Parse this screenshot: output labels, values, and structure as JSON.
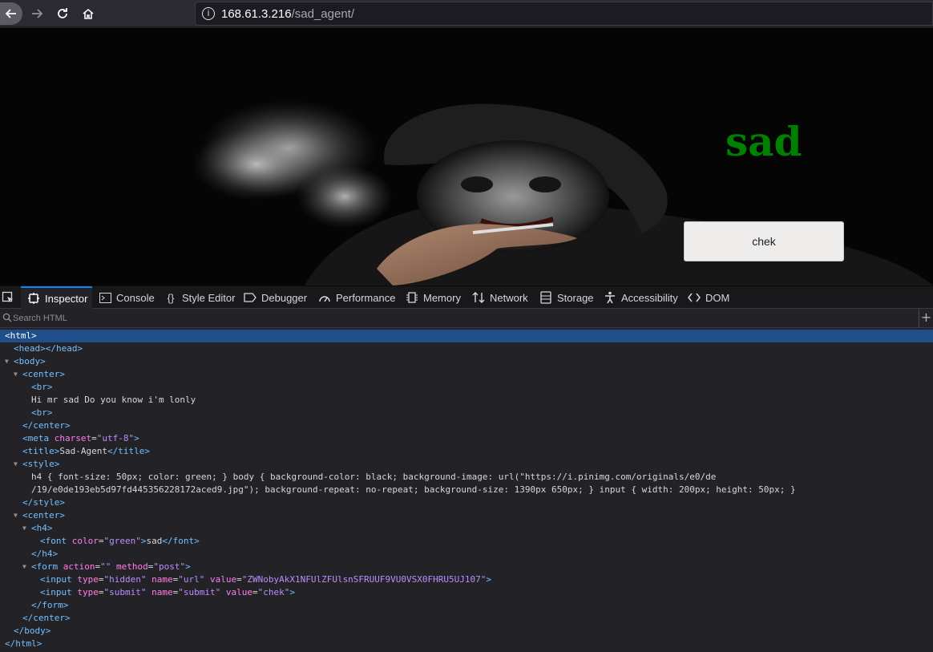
{
  "browser": {
    "url_host": "168.61.3.216",
    "url_path": "/sad_agent/"
  },
  "page": {
    "heading": "sad",
    "submit_label": "chek",
    "colors": {
      "heading": "#008000",
      "background": "#000000"
    }
  },
  "devtools": {
    "tabs": [
      {
        "label": "Inspector",
        "icon": "inspector-icon",
        "active": true
      },
      {
        "label": "Console",
        "icon": "console-icon"
      },
      {
        "label": "Style Editor",
        "icon": "style-editor-icon"
      },
      {
        "label": "Debugger",
        "icon": "debugger-icon"
      },
      {
        "label": "Performance",
        "icon": "performance-icon"
      },
      {
        "label": "Memory",
        "icon": "memory-icon"
      },
      {
        "label": "Network",
        "icon": "network-icon"
      },
      {
        "label": "Storage",
        "icon": "storage-icon"
      },
      {
        "label": "Accessibility",
        "icon": "accessibility-icon"
      },
      {
        "label": "DOM",
        "icon": "dom-icon"
      }
    ],
    "search_placeholder": "Search HTML",
    "tree": {
      "html_open": "html",
      "head": "head",
      "body": "body",
      "center": "center",
      "br": "br",
      "text_line": "Hi mr sad Do you know i'm lonly",
      "meta": "meta",
      "meta_attr": "charset",
      "meta_val": "\"utf-8\"",
      "title_tag": "title",
      "title_text": "Sad-Agent",
      "style": "style",
      "style_line1": "h4 { font-size: 50px; color: green; } body { background-color: black; background-image: url(\"https://i.pinimg.com/originals/e0/de",
      "style_line2": "/19/e0de193eb5d97fd445356228172aced9.jpg\"); background-repeat: no-repeat; background-size: 1390px 650px; } input { width: 200px; height: 50px; }",
      "h4": "h4",
      "font": "font",
      "font_attr": "color",
      "font_val": "\"green\"",
      "font_text": "sad",
      "form": "form",
      "form_attr1": "action",
      "form_val1": "\"\"",
      "form_attr2": "method",
      "form_val2": "\"post\"",
      "input": "input",
      "input1_attr1": "type",
      "input1_val1": "\"hidden\"",
      "input1_attr2": "name",
      "input1_val2": "\"url\"",
      "input1_attr3": "value",
      "input1_val3": "\"ZWNobyAkX1NFUlZFUlsnSFRUUF9VU0VSX0FHRU5UJ107\"",
      "input2_attr1": "type",
      "input2_val1": "\"submit\"",
      "input2_attr2": "name",
      "input2_val2": "\"submit\"",
      "input2_attr3": "value",
      "input2_val3": "\"chek\""
    }
  }
}
